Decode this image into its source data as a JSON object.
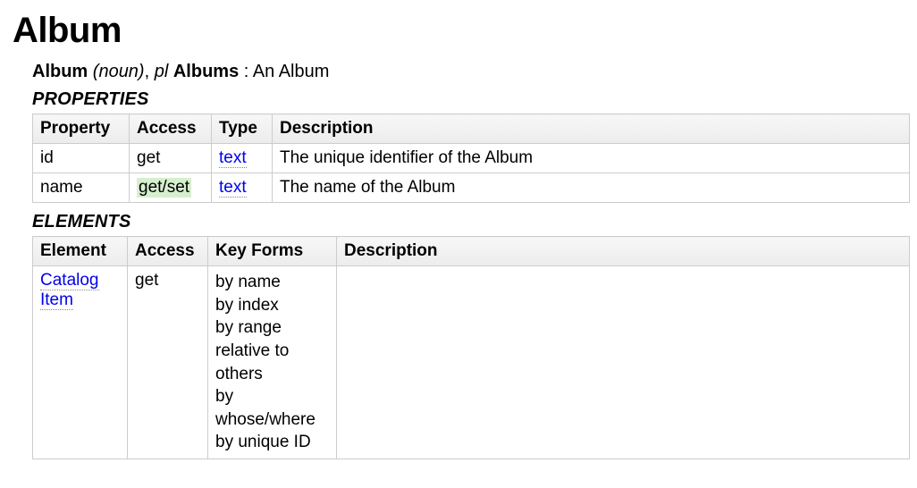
{
  "title": "Album",
  "definition": {
    "term": "Album",
    "pos": "(noun)",
    "separator": ", ",
    "plural_abbr": "pl",
    "plural": "Albums",
    "colon": " : ",
    "description": "An Album"
  },
  "properties": {
    "heading": "PROPERTIES",
    "columns": {
      "property": "Property",
      "access": "Access",
      "type": "Type",
      "description": "Description"
    },
    "rows": [
      {
        "property": "id",
        "access": "get",
        "access_highlight": false,
        "type": "text",
        "type_link": true,
        "description": "The unique identifier of the Album"
      },
      {
        "property": "name",
        "access": "get/set",
        "access_highlight": true,
        "type": "text",
        "type_link": true,
        "description": "The name of the Album"
      }
    ]
  },
  "elements": {
    "heading": "ELEMENTS",
    "columns": {
      "element": "Element",
      "access": "Access",
      "keyforms": "Key Forms",
      "description": "Description"
    },
    "rows": [
      {
        "element": "Catalog Item",
        "element_link": true,
        "access": "get",
        "keyforms": [
          "by name",
          "by index",
          "by range",
          "relative to others",
          "by whose/where",
          "by unique ID"
        ],
        "description": ""
      }
    ]
  }
}
